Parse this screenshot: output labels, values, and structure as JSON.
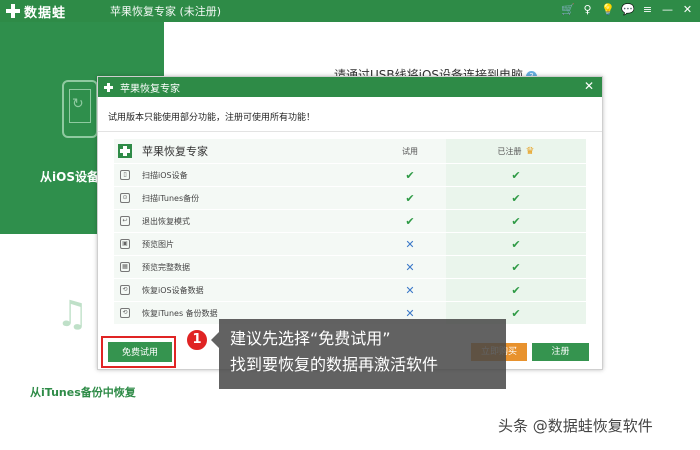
{
  "titlebar": {
    "logo_text": "数据蛙",
    "app_title": "苹果恢复专家 (未注册)",
    "icons": [
      "cart-icon",
      "key-icon",
      "bulb-icon",
      "chat-icon",
      "menu-icon",
      "minimize-icon",
      "close-icon"
    ],
    "icon_glyphs": [
      "🛒",
      "♀",
      "💡",
      "💬",
      "≡",
      "—",
      "✕"
    ]
  },
  "left_panel": {
    "top_label": "从iOS设备中恢复",
    "bottom_label": "从iTunes备份中恢复"
  },
  "background": {
    "prompt": "请通过USB线将iOS设备连接到电脑"
  },
  "dialog": {
    "title": "苹果恢复专家",
    "notice": "试用版本只能使用部分功能，注册可使用所有功能！",
    "header": {
      "name": "苹果恢复专家",
      "trial_col": "试用",
      "registered_col": "已注册"
    },
    "rows": [
      {
        "label": "扫描iOS设备",
        "trial": "check",
        "registered": "check"
      },
      {
        "label": "扫描iTunes备份",
        "trial": "check",
        "registered": "check"
      },
      {
        "label": "退出恢复模式",
        "trial": "check",
        "registered": "check"
      },
      {
        "label": "预览图片",
        "trial": "cross",
        "registered": "check"
      },
      {
        "label": "预览完整数据",
        "trial": "cross",
        "registered": "check"
      },
      {
        "label": "恢复iOS设备数据",
        "trial": "cross",
        "registered": "check"
      },
      {
        "label": "恢复iTunes 备份数据",
        "trial": "cross",
        "registered": "check"
      }
    ],
    "free_trial_label": "免费试用",
    "buy_label": "立即购买",
    "register_label": "注册"
  },
  "annotation": {
    "badge": "1",
    "line1": "建议先选择“免费试用”",
    "line2": "找到要恢复的数据再激活软件"
  },
  "watermark": "头条 @数据蛙恢复软件",
  "colors": {
    "brand_green": "#2e8b47",
    "check_green": "#2e9a45",
    "cross_blue": "#3a78c8",
    "highlight_red": "#e02424",
    "buy_orange": "#e8922e"
  }
}
